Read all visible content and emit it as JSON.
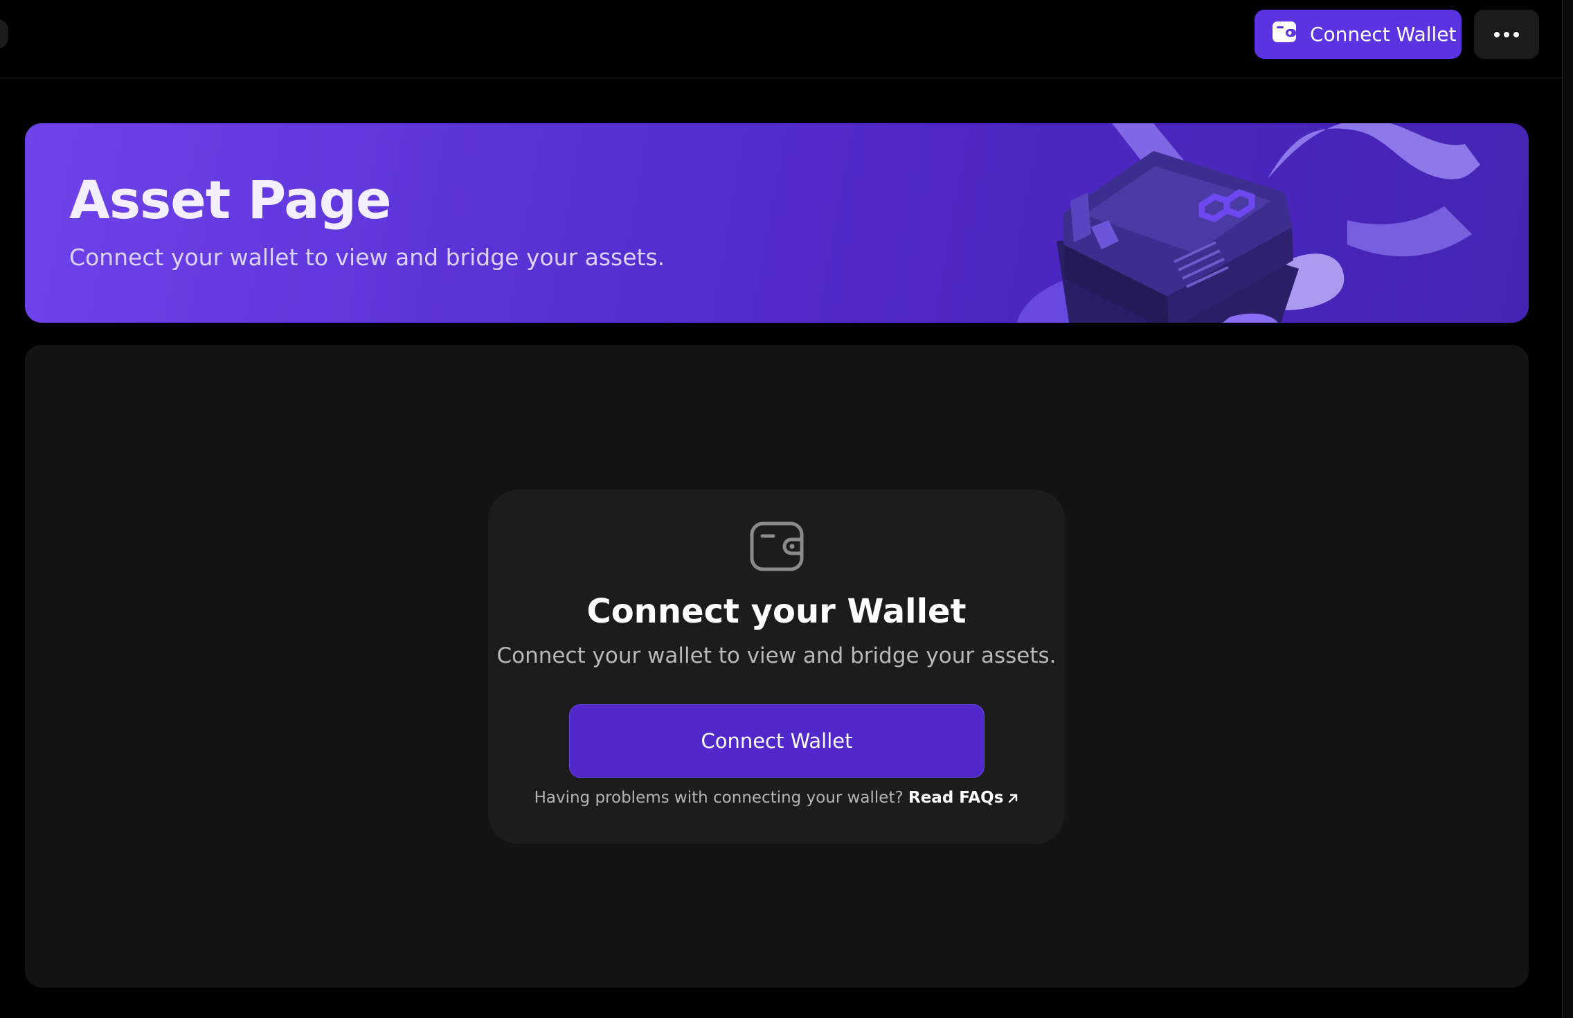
{
  "header": {
    "connect_label": "Connect Wallet",
    "accent": "#5b33e0",
    "icons": [
      "wallet-icon",
      "more-icon"
    ]
  },
  "banner": {
    "title": "Asset Page",
    "subtitle": "Connect your wallet to view and bridge your assets.",
    "gradient_start": "#6f43ea",
    "gradient_end": "#4524b3"
  },
  "connect_card": {
    "icon": "wallet-icon",
    "title": "Connect your Wallet",
    "subtitle": "Connect your wallet to view and bridge your assets.",
    "button_label": "Connect Wallet",
    "button_color": "#5128ca",
    "help_text": "Having problems with connecting your wallet?",
    "faq_label": "Read FAQs",
    "faq_icon": "arrow-up-right-icon"
  }
}
